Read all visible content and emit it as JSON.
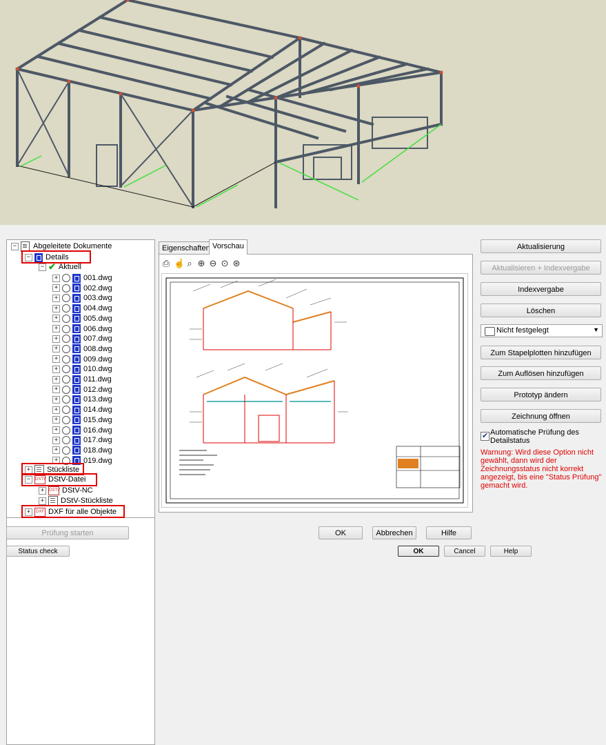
{
  "tree": {
    "root": "Abgeleitete Dokumente",
    "details": "Details",
    "current": "Aktuell",
    "files": [
      "001.dwg",
      "002.dwg",
      "003.dwg",
      "004.dwg",
      "005.dwg",
      "006.dwg",
      "007.dwg",
      "008.dwg",
      "009.dwg",
      "010.dwg",
      "011.dwg",
      "012.dwg",
      "013.dwg",
      "014.dwg",
      "015.dwg",
      "016.dwg",
      "017.dwg",
      "018.dwg",
      "019.dwg"
    ],
    "parts_list": "Stückliste",
    "dstv": "DStV-Datei",
    "dstv_nc": "DStV-NC",
    "dstv_list": "DStV-Stückliste",
    "dxf": "DXF für alle Objekte"
  },
  "tabs": [
    "Eigenschaften",
    "Vorschau"
  ],
  "toolbar_icons": [
    "print-icon",
    "pan-icon",
    "zoom-window-icon",
    "zoom-in-icon",
    "zoom-out-icon",
    "zoom-extents-icon",
    "zoom-center-icon"
  ],
  "right": {
    "aktualisierung": "Aktualisierung",
    "aktualisieren_index": "Aktualisieren + Indexvergabe",
    "indexvergabe": "Indexvergabe",
    "loeschen": "Löschen",
    "status_select": "Nicht festgelegt",
    "stapelplotten": "Zum Stapelplotten hinzufügen",
    "aufloesen": "Zum Auflösen hinzufügen",
    "prototyp": "Prototyp ändern",
    "zeichnung_oeffnen": "Zeichnung öffnen",
    "auto_check_label": "Automatische Prüfung des Detailstatus",
    "auto_check_checked": true,
    "warning": "Warnung: Wird diese Option nicht gewählt, dann wird der Zeichnungsstatus nicht korrekt angezeigt, bis eine \"Status Prüfung\" gemacht wird."
  },
  "bottom": {
    "pruefung_starten": "Prüfung starten",
    "ok_de": "OK",
    "abbrechen": "Abbrechen",
    "hilfe": "Hilfe",
    "status_check": "Status check",
    "ok_en": "OK",
    "cancel": "Cancel",
    "help": "Help"
  },
  "colors": {
    "highlight_box": "#e00000",
    "selection": "#2a46d0",
    "warning": "#e00000",
    "viewport_bg": "#dcd9c4",
    "steel": "#5a6470"
  }
}
